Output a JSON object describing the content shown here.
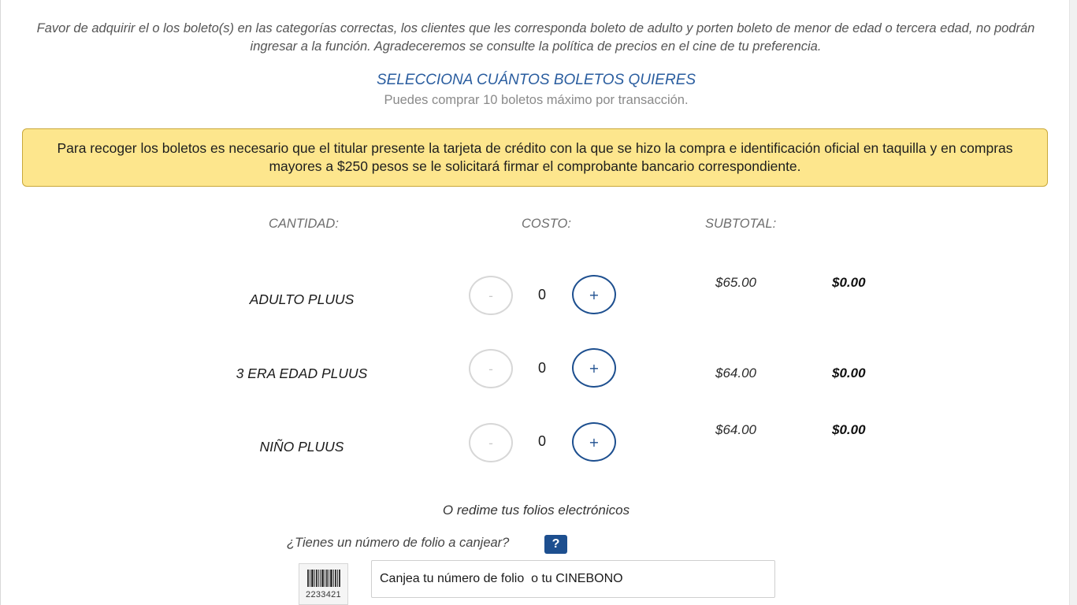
{
  "notice_text": "Favor de adquirir el o los boleto(s) en las categorías correctas, los clientes que les corresponda boleto de adulto y porten boleto de menor de edad o tercera edad, no podrán ingresar a la función. Agradeceremos se consulte la política de precios en el cine de tu preferencia.",
  "selection": {
    "title": "SELECCIONA CUÁNTOS BOLETOS QUIERES",
    "subtitle": "Puedes comprar 10 boletos máximo por transacción."
  },
  "warning_text": "Para recoger los boletos es necesario que el titular presente la tarjeta de crédito con la que se hizo la compra e identificación oficial en taquilla y en compras mayores a $250 pesos se le solicitará firmar el comprobante bancario correspondiente.",
  "columns": {
    "quantity": "CANTIDAD:",
    "cost": "COSTO:",
    "subtotal": "SUBTOTAL:"
  },
  "tickets": [
    {
      "name": "ADULTO PLUUS",
      "quantity": "0",
      "price": "$65.00",
      "subtotal": "$0.00",
      "minus": "-",
      "plus": "+"
    },
    {
      "name": "3 ERA EDAD PLUUS",
      "quantity": "0",
      "price": "$64.00",
      "subtotal": "$0.00",
      "minus": "-",
      "plus": "+"
    },
    {
      "name": "NIÑO PLUUS",
      "quantity": "0",
      "price": "$64.00",
      "subtotal": "$0.00",
      "minus": "-",
      "plus": "+"
    }
  ],
  "redeem": {
    "title": "O redime tus folios electrónicos",
    "question": "¿Tienes un número de folio a canjear?",
    "help": "?",
    "barcode_number": "2233421",
    "input_placeholder": "Canjea tu número de folio  o tu CINEBONO",
    "input_value": ""
  },
  "colors": {
    "accent_blue": "#1d4f8f",
    "title_blue": "#2a5d9f",
    "warning_bg": "#fde68d",
    "warning_border": "#c9a83a"
  },
  "icons": {
    "help": "question-mark-icon",
    "barcode": "barcode-icon"
  }
}
